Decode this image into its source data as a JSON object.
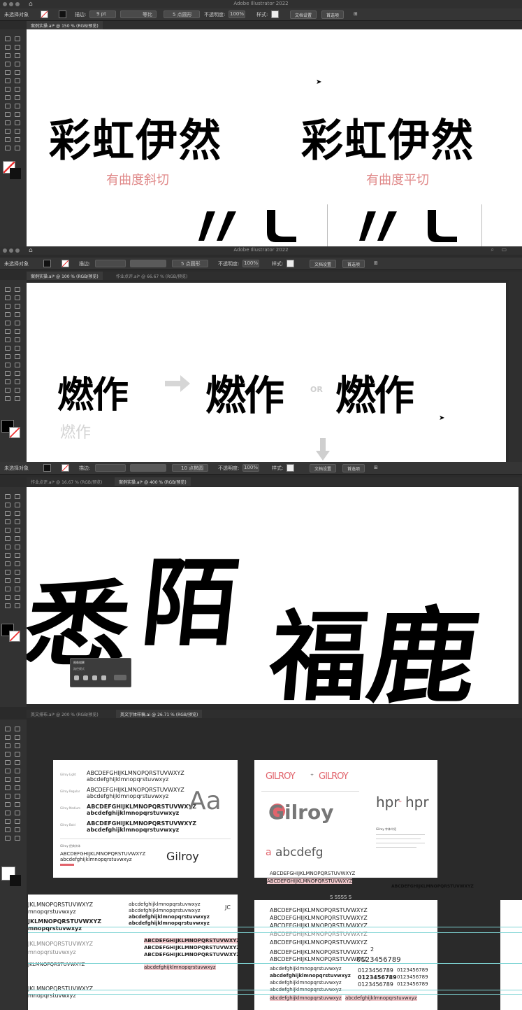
{
  "panel1": {
    "app_title": "Adobe Illustrator 2022",
    "control": {
      "selection": "未选择对象",
      "stroke_label": "描边:",
      "stroke_value": "9 pt",
      "profile": "等比",
      "brush": "5 点圆形",
      "opacity_label": "不透明度:",
      "opacity_value": "100%",
      "style_label": "样式:",
      "doc_settings": "文档设置",
      "prefs": "首选项"
    },
    "tab": "案例实操.ai* @ 150 % (RGB/预览)",
    "words": [
      "彩虹伊然",
      "彩虹伊然"
    ],
    "captions": [
      "有曲度斜切",
      "有曲度平切"
    ]
  },
  "panel2": {
    "app_title": "Adobe Illustrator 2022",
    "control": {
      "selection": "未选择对象",
      "stroke_label": "描边:",
      "brush": "5 点圆形",
      "opacity_label": "不透明度:",
      "opacity_value": "100%",
      "style_label": "样式:",
      "doc_settings": "文档设置",
      "prefs": "首选项"
    },
    "tabs": [
      "案例实操.ai* @ 100 % (RGB/预览)",
      "作业点评.ai* @ 66.67 % (RGB/预览)"
    ],
    "words": [
      "燃作",
      "燃作",
      "燃作"
    ],
    "or_label": "OR",
    "ghost_word": "燃作"
  },
  "panel3": {
    "control": {
      "selection": "未选择对象",
      "stroke_label": "描边:",
      "brush": "10 点椭圆",
      "opacity_label": "不透明度:",
      "opacity_value": "100%",
      "style_label": "样式:",
      "doc_settings": "文档设置",
      "prefs": "首选项"
    },
    "tabs": [
      "作业点评.ai* @ 16.67 % (RGB/预览)",
      "案例实操.ai* @ 400 % (RGB/预览)"
    ],
    "chars": [
      "悉",
      "陌",
      "福",
      "鹿"
    ],
    "popup": {
      "title": "图像描摹",
      "sub": "路径模式"
    }
  },
  "panel4": {
    "tabs": [
      "英文排布.ai* @ 200 % (RGB/预览)",
      "英文字体样稿.ai @ 26.71 % (RGB/预览)"
    ],
    "sheet_a": {
      "weights": [
        "Gilroy Light",
        "Gilroy Regular",
        "Gilroy Medium",
        "Gilroy Bold"
      ],
      "upper": "ABCDEFGHIJKLMNOPQRSTUVWXYZ",
      "lower": "abcdefghijklmnopqrstuvwxyz",
      "aa": "Aa",
      "brand": "Gilroy",
      "caption": "Gilroy 经典字体"
    },
    "sheet_b": {
      "logo1": "GILROY",
      "logo2": "GILROY",
      "hero": "Gilroy",
      "sample": "abcdefg",
      "hpr": "hpr",
      "hpr2": "hpr",
      "upper": "ABCDEFGHIJKLMNOPQRSTUVWXYZ",
      "upper_hl": "ABCDEFGHIJKLMNOPQRSTUVWXYZ",
      "note": "Gilroy 字体介绍",
      "right_caps": "ABCDEFGHIJKLMNOPQRSTUVWXYZ"
    },
    "sheet_c": {
      "upper": "JKLMNOPQRSTUVWXYZ",
      "lower": "mnopqrstuvwxyz",
      "lower_full": "abcdefghijklmnopqrstuvwxyz",
      "upper_full": "ABCDEFGHIJKLMNOPQRSTUVWXYZ",
      "jc": "JC"
    },
    "sheet_d": {
      "sssss": "S SSSS S",
      "upper": "ABCDEFGHIJKLMNOPQRSTUVWXYZ",
      "lower": "abcdefghijklmnopqrstuvwxyz",
      "digits": "0123456789",
      "two": "2"
    }
  }
}
